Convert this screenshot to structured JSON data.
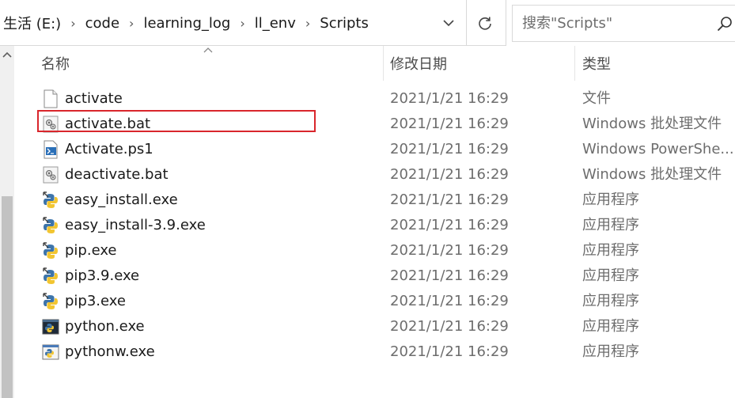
{
  "breadcrumb": [
    "生活 (E:)",
    "code",
    "learning_log",
    "ll_env",
    "Scripts"
  ],
  "search": {
    "placeholder": "搜索\"Scripts\""
  },
  "columns": {
    "name": "名称",
    "date": "修改日期",
    "type": "类型"
  },
  "files": [
    {
      "name": "activate",
      "date": "2021/1/21 16:29",
      "type": "文件",
      "icon": "blank-file-icon"
    },
    {
      "name": "activate.bat",
      "date": "2021/1/21 16:29",
      "type": "Windows 批处理文件",
      "icon": "batch-file-icon"
    },
    {
      "name": "Activate.ps1",
      "date": "2021/1/21 16:29",
      "type": "Windows PowerShe...",
      "icon": "powershell-script-icon"
    },
    {
      "name": "deactivate.bat",
      "date": "2021/1/21 16:29",
      "type": "Windows 批处理文件",
      "icon": "batch-file-icon"
    },
    {
      "name": "easy_install.exe",
      "date": "2021/1/21 16:29",
      "type": "应用程序",
      "icon": "python-exe-icon"
    },
    {
      "name": "easy_install-3.9.exe",
      "date": "2021/1/21 16:29",
      "type": "应用程序",
      "icon": "python-exe-icon"
    },
    {
      "name": "pip.exe",
      "date": "2021/1/21 16:29",
      "type": "应用程序",
      "icon": "python-exe-icon"
    },
    {
      "name": "pip3.9.exe",
      "date": "2021/1/21 16:29",
      "type": "应用程序",
      "icon": "python-exe-icon"
    },
    {
      "name": "pip3.exe",
      "date": "2021/1/21 16:29",
      "type": "应用程序",
      "icon": "python-exe-icon"
    },
    {
      "name": "python.exe",
      "date": "2021/1/21 16:29",
      "type": "应用程序",
      "icon": "python-console-icon"
    },
    {
      "name": "pythonw.exe",
      "date": "2021/1/21 16:29",
      "type": "应用程序",
      "icon": "python-window-icon"
    }
  ],
  "colors": {
    "highlight_box": "#d9262c",
    "muted_text": "#6d6d6d"
  }
}
